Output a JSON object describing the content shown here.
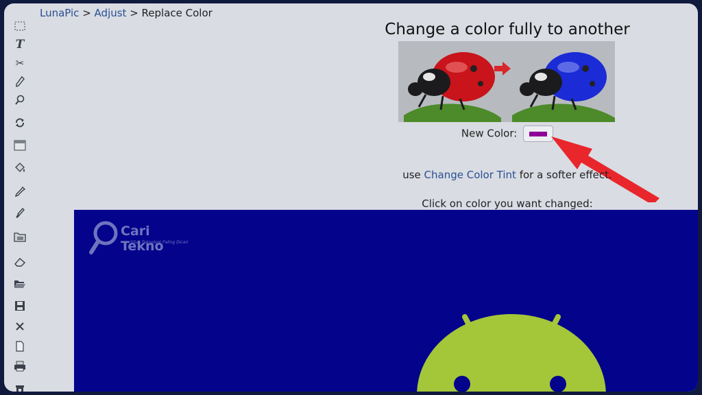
{
  "breadcrumb": {
    "home": "LunaPic",
    "sep1": " > ",
    "section": "Adjust",
    "sep2": " > ",
    "current": "Replace Color"
  },
  "heading": "Change a color fully to another",
  "new_color": {
    "label": "New Color:",
    "value": "#8e0097"
  },
  "tip": {
    "prefix": "use ",
    "link": "Change Color Tint",
    "suffix": " for a softer effect."
  },
  "instruction": "Click on color you want changed:",
  "watermark": {
    "title": "Cari Tekno",
    "subtitle": "Situs Teknologi Paling Dicari"
  },
  "colors": {
    "canvas_bg": "#03038c",
    "android_green": "#a4c639",
    "arrow_red": "#e8262b",
    "link": "#2a4f91"
  },
  "toolbar": [
    {
      "icon": "marquee-select-icon"
    },
    {
      "icon": "text-tool-icon"
    },
    {
      "icon": "scissors-icon"
    },
    {
      "icon": "pencil-icon"
    },
    {
      "icon": "magnifier-icon"
    },
    {
      "icon": "rotate-icon"
    },
    {
      "icon": "layers-icon"
    },
    {
      "icon": "paint-bucket-icon"
    },
    {
      "icon": "eyedropper-icon"
    },
    {
      "icon": "brush-icon"
    },
    {
      "icon": "folder-image-icon"
    },
    {
      "icon": "eraser-icon"
    },
    {
      "icon": "open-folder-icon"
    },
    {
      "icon": "save-icon"
    },
    {
      "icon": "close-icon"
    },
    {
      "icon": "new-file-icon"
    },
    {
      "icon": "print-icon"
    },
    {
      "icon": "trash-icon"
    }
  ]
}
